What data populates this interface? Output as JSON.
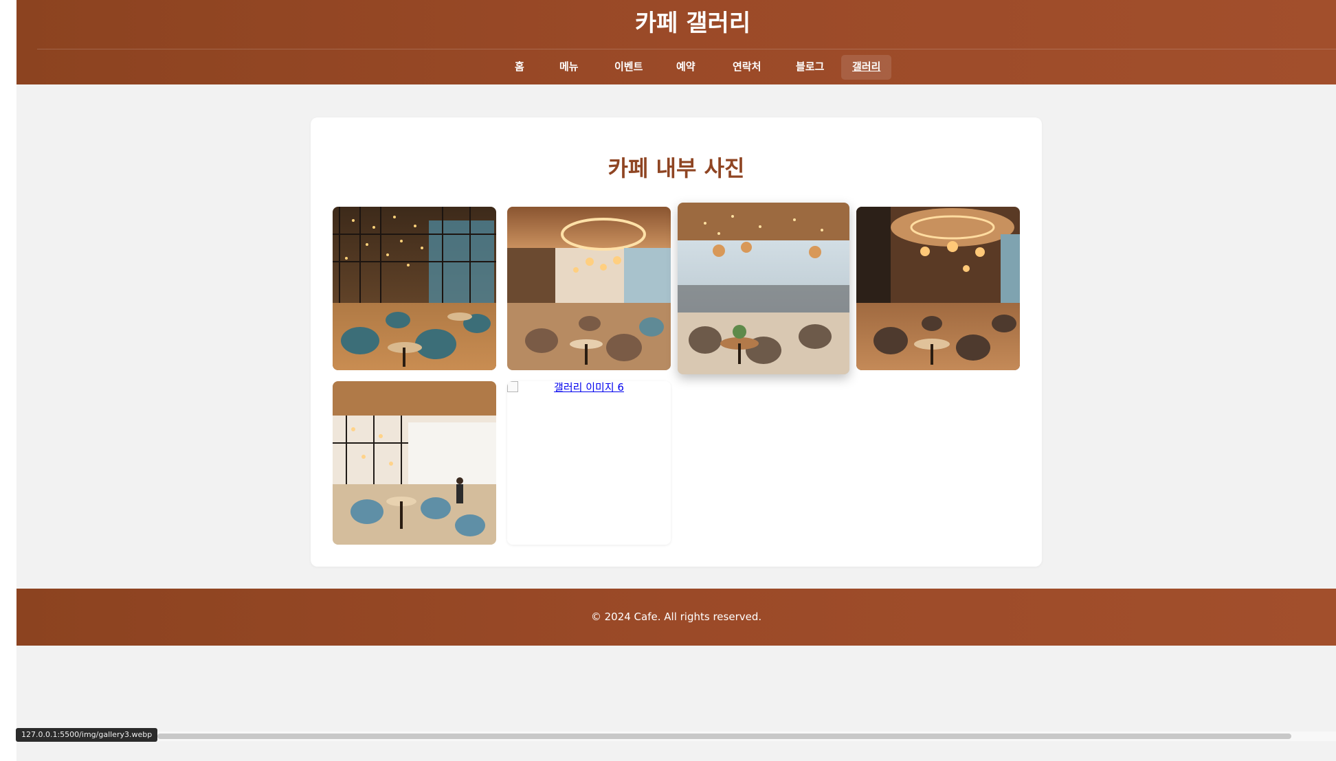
{
  "header": {
    "title": "카페 갤러리",
    "nav": [
      {
        "label": "홈"
      },
      {
        "label": "메뉴"
      },
      {
        "label": "이벤트"
      },
      {
        "label": "예약"
      },
      {
        "label": "연락처"
      },
      {
        "label": "블로그"
      },
      {
        "label": "갤러리",
        "active": true
      }
    ]
  },
  "main": {
    "title": "카페 내부 사진",
    "images": [
      {
        "alt": "갤러리 이미지 1",
        "loaded": true
      },
      {
        "alt": "갤러리 이미지 2",
        "loaded": true
      },
      {
        "alt": "갤러리 이미지 3",
        "loaded": true,
        "hovered": true
      },
      {
        "alt": "갤러리 이미지 4",
        "loaded": true
      },
      {
        "alt": "갤러리 이미지 5",
        "loaded": true
      },
      {
        "alt": "갤러리 이미지 6",
        "loaded": false
      }
    ]
  },
  "footer": {
    "text": "© 2024 Cafe. All rights reserved."
  },
  "status_bar": {
    "url": "127.0.0.1:5500/img/gallery3.webp"
  },
  "colors": {
    "header_bg": "#9b4a28",
    "accent_title": "#8f4523",
    "page_bg": "#f2f2f2",
    "link": "#0000ee"
  }
}
